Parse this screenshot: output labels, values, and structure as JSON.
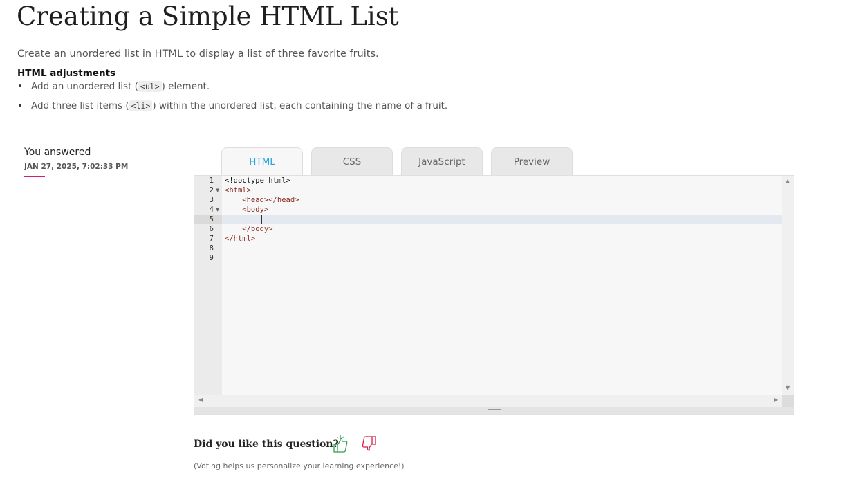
{
  "page": {
    "title": "Creating a Simple HTML List",
    "description": "Create an unordered list in HTML to display a list of three favorite fruits."
  },
  "adjustments": {
    "heading": "HTML adjustments",
    "items": [
      {
        "before": "Add an unordered list (",
        "code": "<ul>",
        "after": ") element."
      },
      {
        "before": "Add three list items (",
        "code": "<li>",
        "after": ") within the unordered list, each containing the name of a fruit."
      }
    ]
  },
  "answer": {
    "label": "You answered",
    "date": "JAN 27, 2025, 7:02:33 PM",
    "accent_color": "#d81b78"
  },
  "editor": {
    "tabs": [
      {
        "label": "HTML",
        "active": true
      },
      {
        "label": "CSS",
        "active": false
      },
      {
        "label": "JavaScript",
        "active": false
      },
      {
        "label": "Preview",
        "active": false
      }
    ],
    "active_line": 5,
    "lines": [
      {
        "num": "1",
        "text": "<!doctype html>"
      },
      {
        "num": "2",
        "text": "<html>"
      },
      {
        "num": "3",
        "text": "    <head></head>"
      },
      {
        "num": "4",
        "text": "    <body>"
      },
      {
        "num": "5",
        "text": ""
      },
      {
        "num": "6",
        "text": "    </body>"
      },
      {
        "num": "7",
        "text": "</html>"
      },
      {
        "num": "8",
        "text": ""
      },
      {
        "num": "9",
        "text": ""
      }
    ]
  },
  "feedback": {
    "question": "Did you like this question?",
    "note": "(Voting helps us personalize your learning experience!)",
    "thumbs_up_color": "#2e9e4f",
    "thumbs_down_color": "#d81b4a"
  }
}
